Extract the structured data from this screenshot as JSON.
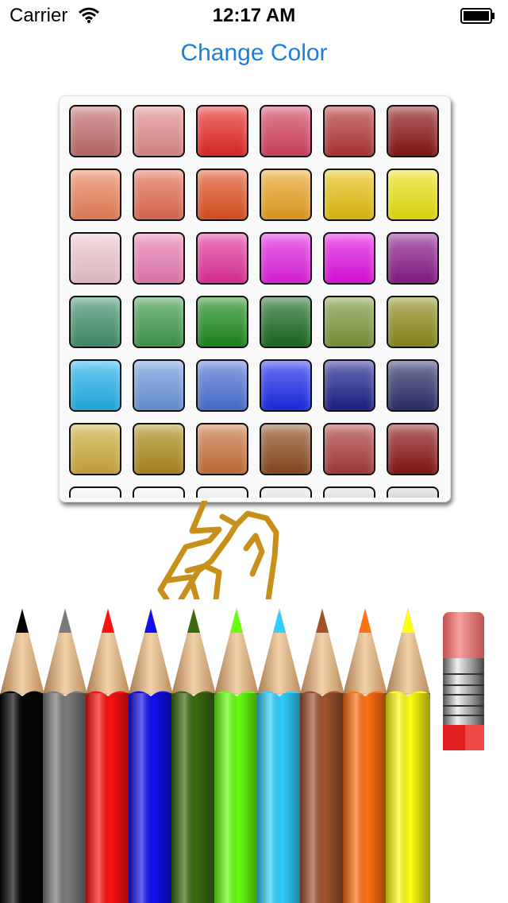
{
  "status_bar": {
    "carrier": "Carrier",
    "time": "12:17 AM"
  },
  "header": {
    "change_color_label": "Change Color"
  },
  "palette": {
    "rows": [
      [
        "#c06a6a",
        "#e08a8a",
        "#e52727",
        "#d3405f",
        "#b23434",
        "#8a1414"
      ],
      [
        "#ea8058",
        "#e26a52",
        "#e05020",
        "#e8a020",
        "#e3c010",
        "#e8e010"
      ],
      [
        "#ecc4cc",
        "#e87ab0",
        "#e2309a",
        "#e020e0",
        "#e010e0",
        "#8a1a8a"
      ],
      [
        "#3f8f6a",
        "#3f9a4a",
        "#1a8a1a",
        "#1a6a20",
        "#7a963a",
        "#8a8a1a"
      ],
      [
        "#20b0e8",
        "#6a96dc",
        "#4a70d4",
        "#1a2ae8",
        "#1a208a",
        "#2a2e6a"
      ],
      [
        "#ccaa3a",
        "#ad8a1a",
        "#c8703a",
        "#8a4a20",
        "#a83a3a",
        "#8a1414"
      ],
      [
        "#f2f2f2",
        "#f2f2f2",
        "#eaeaea",
        "#e0e0e0",
        "#d8d8d8",
        "#cccccc"
      ]
    ]
  },
  "drawing": {
    "stroke_color": "#c8901a"
  },
  "pencils": [
    {
      "name": "black",
      "color": "#050505"
    },
    {
      "name": "gray",
      "color": "#7a7a7a"
    },
    {
      "name": "red",
      "color": "#ff1010"
    },
    {
      "name": "blue",
      "color": "#1010ee"
    },
    {
      "name": "dark-green",
      "color": "#3a6a10"
    },
    {
      "name": "lime",
      "color": "#66ff10"
    },
    {
      "name": "cyan",
      "color": "#30d0ff"
    },
    {
      "name": "brown",
      "color": "#a0522d"
    },
    {
      "name": "orange",
      "color": "#ff7010"
    },
    {
      "name": "yellow",
      "color": "#ffff10"
    }
  ],
  "eraser": {
    "label": "eraser"
  }
}
